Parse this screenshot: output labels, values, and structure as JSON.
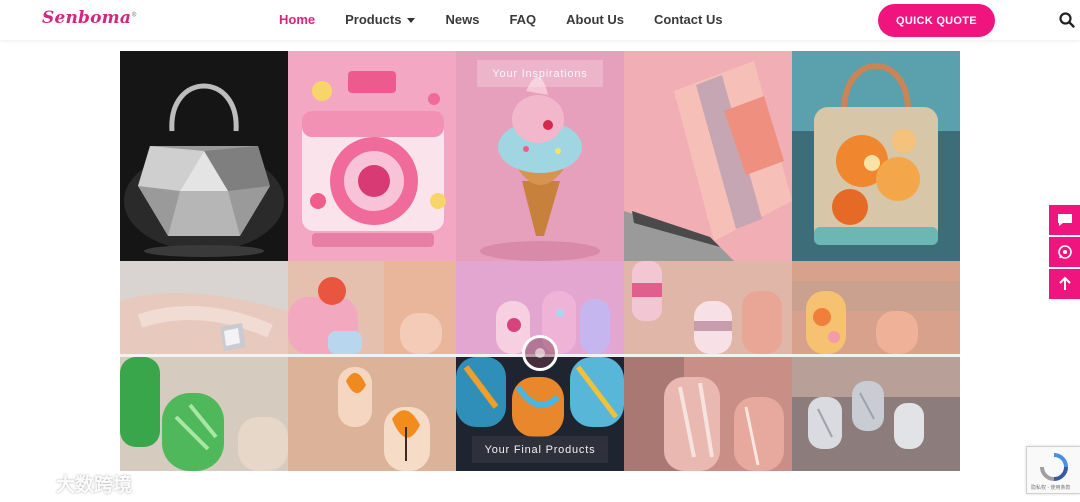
{
  "brand": {
    "logo_text": "Senboma",
    "logo_mark": "®",
    "color": "#d8237f"
  },
  "nav": {
    "items": [
      {
        "label": "Home",
        "active": true
      },
      {
        "label": "Products",
        "has_dropdown": true
      },
      {
        "label": "News"
      },
      {
        "label": "FAQ"
      },
      {
        "label": "About Us"
      },
      {
        "label": "Contact Us"
      }
    ],
    "cta_label": "QUICK QUOTE",
    "accent": "#f0147f"
  },
  "gallery": {
    "top_label": "Your Inspirations",
    "bottom_label": "Your Final Products",
    "inspirations": [
      "crystal-handbag-image",
      "pink-camera-image",
      "ice-cream-image",
      "laptop-image",
      "glass-flower-handbag-image"
    ],
    "nail_designs": [
      "silver-geometric-nails",
      "candy-pink-nails",
      "ice-cream-nails",
      "pastel-block-nails",
      "glass-flower-nails"
    ],
    "final_products": [
      "green-glass-nails",
      "orange-tulip-nails",
      "abstract-blue-orange-nails",
      "glossy-stripe-nails",
      "silver-chrome-nails"
    ]
  },
  "float_bar": {
    "icons": [
      "message-icon",
      "whatsapp-icon",
      "arrow-up-icon"
    ]
  },
  "recaptcha": {
    "text": "隐私权 - 使用条款"
  },
  "watermark": {
    "text": "大数跨境"
  }
}
